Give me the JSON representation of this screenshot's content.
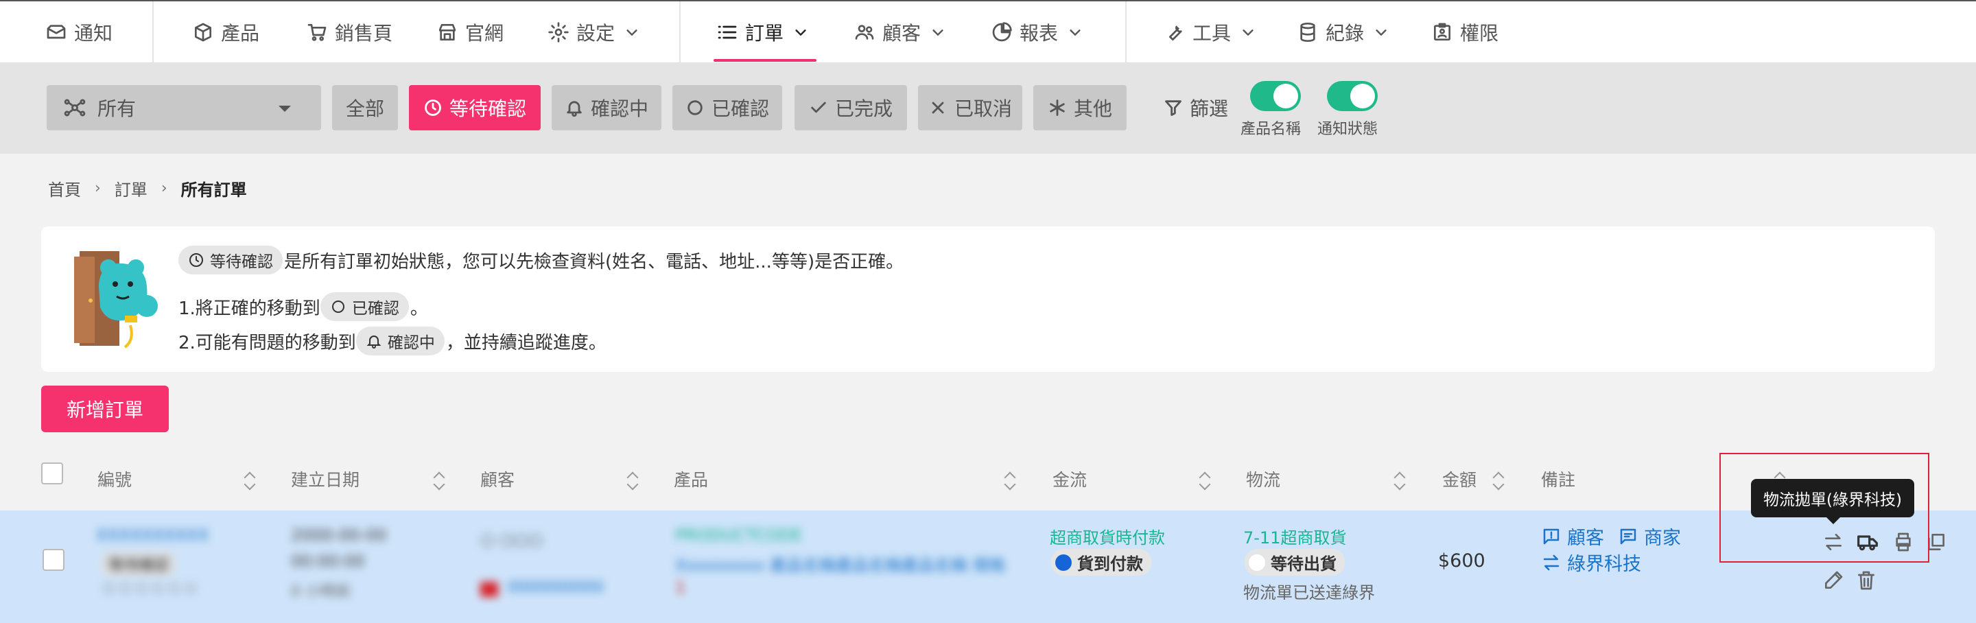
{
  "nav": {
    "notify": "通知",
    "products": "產品",
    "sales_page": "銷售頁",
    "website": "官網",
    "settings": "設定",
    "orders": "訂單",
    "customers": "顧客",
    "reports": "報表",
    "tools": "工具",
    "records": "紀錄",
    "permissions": "權限"
  },
  "filters": {
    "select_value": "所有",
    "all": "全部",
    "pending": "等待確認",
    "confirming": "確認中",
    "confirmed": "已確認",
    "completed": "已完成",
    "cancelled": "已取消",
    "other": "其他",
    "filter": "篩選",
    "toggle_product_name": "產品名稱",
    "toggle_notify_status": "通知狀態"
  },
  "breadcrumb": {
    "home": "首頁",
    "orders": "訂單",
    "current": "所有訂單"
  },
  "info": {
    "pill_pending": "等待確認",
    "line1_text": "是所有訂單初始狀態，您可以先檢查資料(姓名、電話、地址...等等)是否正確。",
    "line2_prefix": "1.將正確的移動到",
    "pill_confirmed": "已確認",
    "line2_suffix": "。",
    "line3_prefix": "2.可能有問題的移動到",
    "pill_confirming": "確認中",
    "line3_suffix": "，並持續追蹤進度。"
  },
  "add_order_label": "新增訂單",
  "table": {
    "headers": {
      "id": "編號",
      "created": "建立日期",
      "customer": "顧客",
      "product": "產品",
      "payment": "金流",
      "logistics": "物流",
      "amount": "金額",
      "notes": "備註"
    },
    "row": {
      "id_blurred": "XXXXXXXXXX",
      "id_status_blurred": "等待確認",
      "id_tags_blurred": "○ ○ ○ ○ ○ ○",
      "date_blurred": "2000-00-00",
      "time_blurred": "00:00:00",
      "date_sub_blurred": "0 小時前",
      "customer_name_blurred": "○ ○○○",
      "customer_phone_blurred": "0000000000",
      "product_sku_blurred": "PRODUCTCODE",
      "product_name_blurred": "Xxxxxxxxx 產品名稱產品名稱產品名稱 規格",
      "product_qty_blurred": "1",
      "payment_method": "超商取貨時付款",
      "payment_status": "貨到付款",
      "logistics_method": "7-11超商取貨",
      "logistics_status": "等待出貨",
      "logistics_note": "物流單已送達綠界",
      "amount": "$600",
      "note_customer": "顧客",
      "note_merchant": "商家",
      "note_ecpay": "綠界科技"
    }
  },
  "tooltip": "物流拋單(綠界科技)",
  "colors": {
    "accent": "#f5316e",
    "toggle_on": "#20b98a",
    "link": "#1a73c8",
    "payment_green": "#18b592",
    "payment_dot": "#1565d8",
    "row_highlight": "#cfe4fa",
    "annotation_red": "#e0203a"
  }
}
